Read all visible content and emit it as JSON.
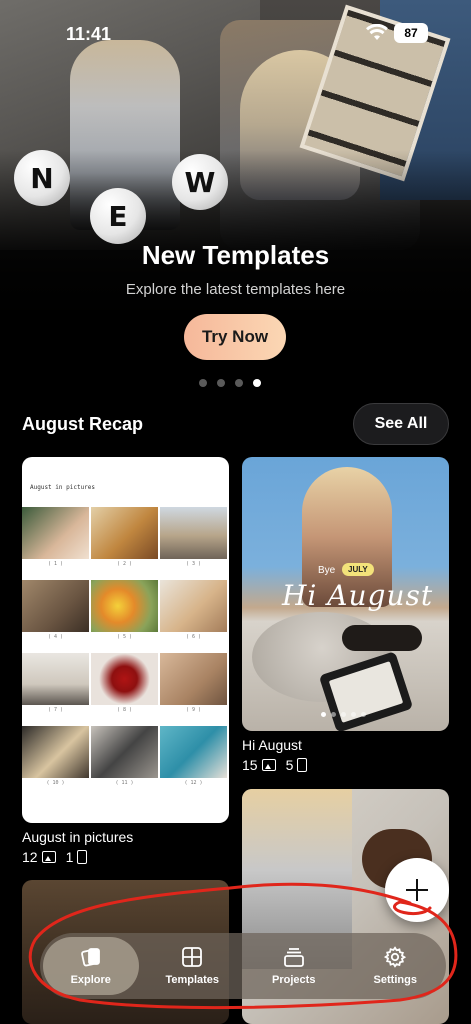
{
  "status_bar": {
    "time": "11:41",
    "battery": "87"
  },
  "hero": {
    "title": "New Templates",
    "subtitle": "Explore the latest templates here",
    "button_label": "Try Now",
    "balls": [
      "N",
      "E",
      "W"
    ],
    "dots_total": 4,
    "dots_active_index": 3
  },
  "section": {
    "title": "August Recap",
    "see_all_label": "See All"
  },
  "card_august_pictures": {
    "inner_title": "August in pictures",
    "cell_labels": [
      "( 1 )",
      "( 2 )",
      "( 3 )",
      "( 4 )",
      "( 5 )",
      "( 6 )",
      "( 7 )",
      "( 8 )",
      "( 9 )",
      "( 10 )",
      "( 11 )",
      "( 12 )"
    ],
    "caption": "August in pictures",
    "images_count": "12",
    "pages_count": "1"
  },
  "card_hi_august": {
    "overlay_bye": "Bye",
    "overlay_july": "JULY",
    "overlay_title": "Hi August",
    "caption": "Hi August",
    "images_count": "15",
    "pages_count": "5"
  },
  "fab": {
    "icon": "plus-icon"
  },
  "nav": {
    "items": [
      {
        "label": "Explore",
        "icon": "cards-icon",
        "active": true
      },
      {
        "label": "Templates",
        "icon": "grid-icon",
        "active": false
      },
      {
        "label": "Projects",
        "icon": "stack-icon",
        "active": false
      },
      {
        "label": "Settings",
        "icon": "gear-icon",
        "active": false
      }
    ]
  },
  "colors": {
    "background": "#000000",
    "try_button_gradient_start": "#f6b89a",
    "try_button_gradient_end": "#fbd7b4",
    "annotation": "#e0261b"
  }
}
